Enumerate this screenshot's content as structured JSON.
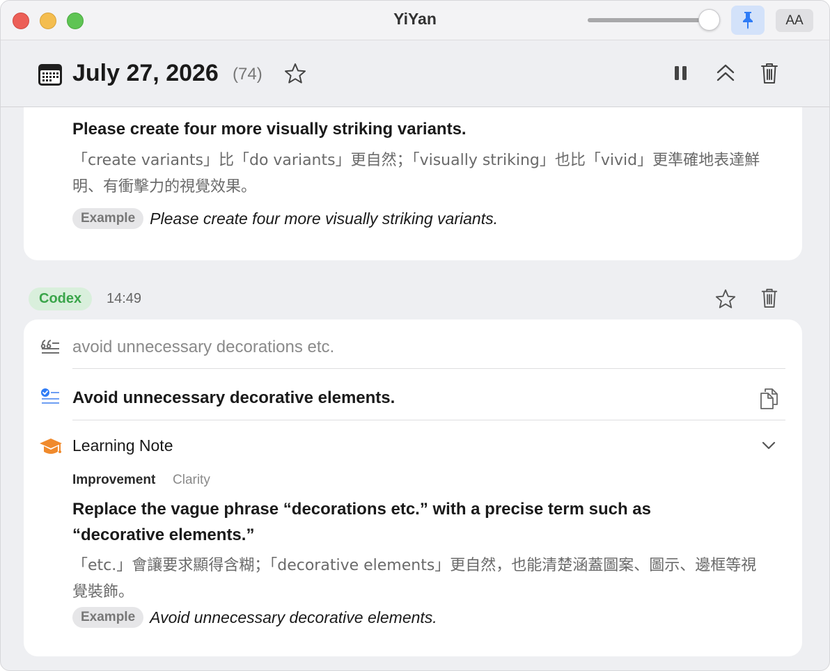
{
  "window": {
    "app_title": "YiYan",
    "font_button_label": "AA",
    "slider_level": 1.0
  },
  "header": {
    "date": "July 27, 2026",
    "count": "(74)"
  },
  "card1": {
    "sentence": "Please create four more visually striking variants.",
    "explanation": "「create variants」比「do variants」更自然；「visually striking」也比「vivid」更準確地表達鮮明、有衝擊力的視覺效果。",
    "example_label": "Example",
    "example_text": "Please create four more visually striking variants."
  },
  "entry": {
    "source_label": "Codex",
    "time": "14:49",
    "original": "avoid unnecessary decorations etc.",
    "corrected": "Avoid unnecessary decorative elements.",
    "note_title": "Learning Note",
    "category": "Improvement",
    "subcategory": "Clarity",
    "note_heading": "Replace the vague phrase “decorations etc.” with a precise term such as “decorative elements.”",
    "note_explanation": "「etc.」會讓要求顯得含糊；「decorative elements」更自然，也能清楚涵蓋圖案、圖示、邊框等視覺裝飾。",
    "example_label": "Example",
    "example_text": "Avoid unnecessary decorative elements."
  },
  "colors": {
    "accent_blue": "#2f7cf6",
    "codex_green": "#3aa54a",
    "note_orange": "#f08a2c"
  }
}
